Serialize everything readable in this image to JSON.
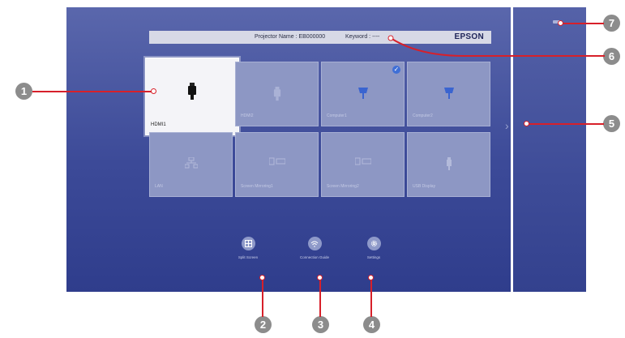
{
  "info_bar": {
    "projector_name": "Projector Name : EB000000",
    "keyword": "Keyword : ----",
    "brand": "EPSON"
  },
  "sources": [
    {
      "label": "HDMI1",
      "icon": "hdmi-icon",
      "selected": true
    },
    {
      "label": "HDMI2",
      "icon": "hdmi-icon"
    },
    {
      "label": "Computer1",
      "icon": "vga-icon",
      "checked": true
    },
    {
      "label": "Computer2",
      "icon": "vga-icon"
    },
    {
      "label": "LAN",
      "icon": "lan-icon"
    },
    {
      "label": "Screen Mirroring1",
      "icon": "screen-mirroring-icon"
    },
    {
      "label": "Screen Mirroring2",
      "icon": "screen-mirroring-icon"
    },
    {
      "label": "USB Display",
      "icon": "usb-icon"
    }
  ],
  "bottom_buttons": [
    {
      "label": "Split Screen",
      "icon": "split-screen-icon"
    },
    {
      "label": "Connection Guide",
      "icon": "connection-guide-icon"
    },
    {
      "label": "Settings",
      "icon": "gear-icon"
    }
  ],
  "callouts": [
    "1",
    "2",
    "3",
    "4",
    "5",
    "6",
    "7"
  ],
  "colors": {
    "callout_line": "#d7202a",
    "marker": "#8c8c8c",
    "accent_check": "#3f6fd6"
  }
}
